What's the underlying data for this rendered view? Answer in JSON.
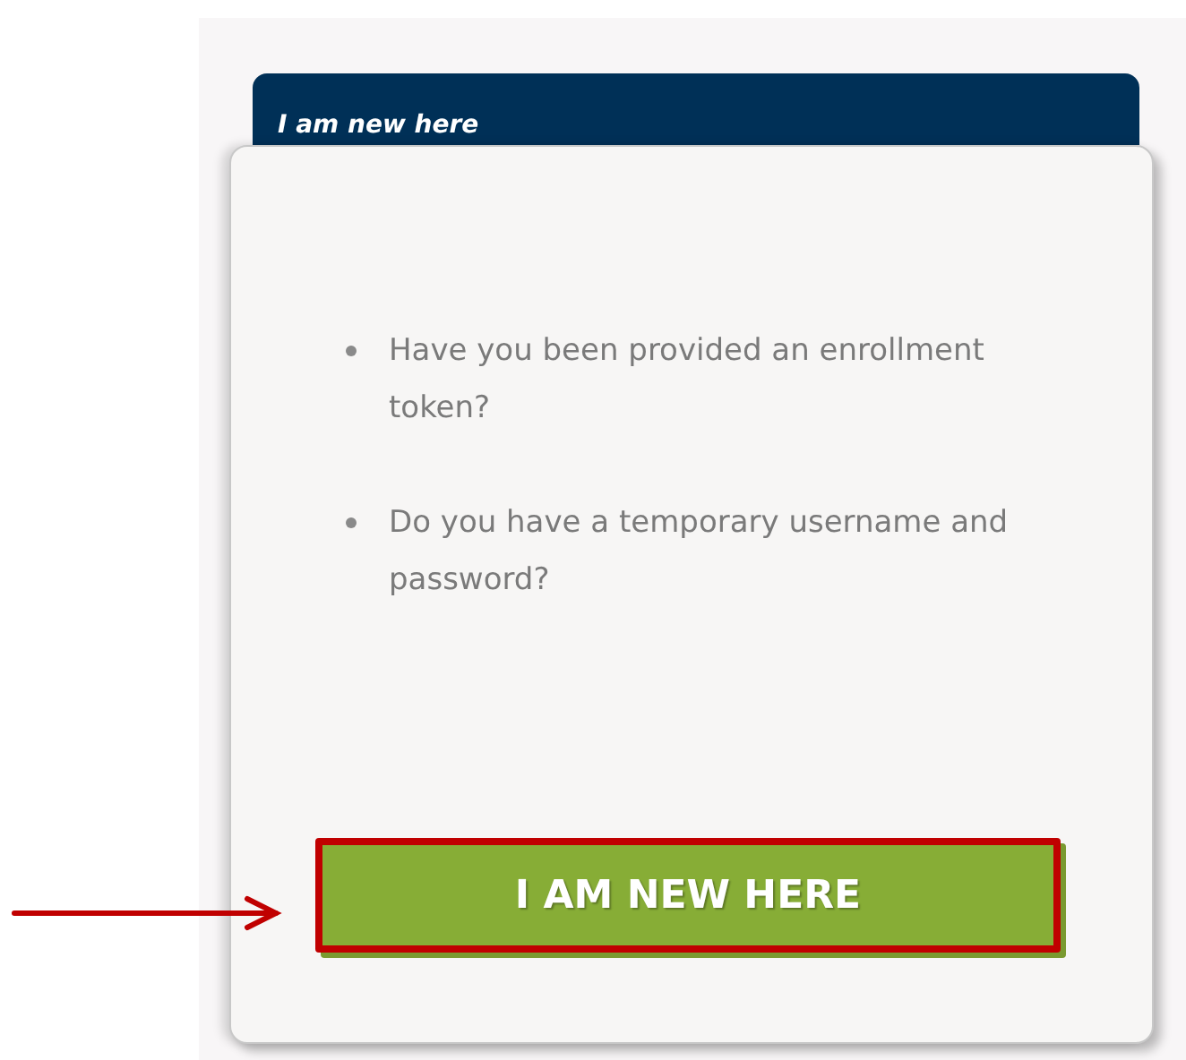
{
  "panel": {
    "title": "I am new here",
    "items": [
      "Have you been provided an enrollment token?",
      "Do you have a temporary username and password?"
    ],
    "button": "I AM NEW HERE"
  }
}
